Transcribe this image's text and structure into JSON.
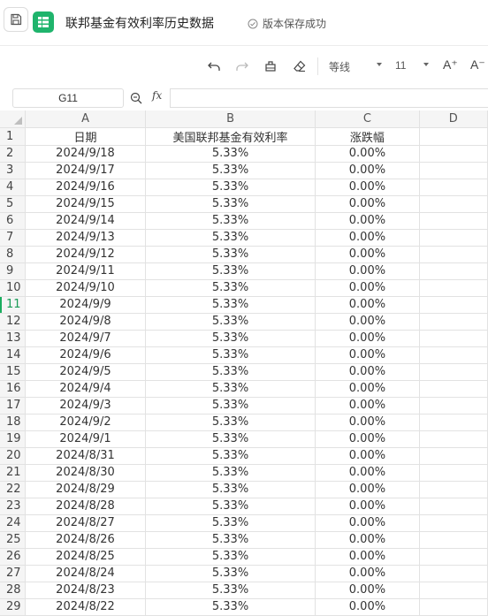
{
  "title_bar": {
    "doc_title": "联邦基金有效利率历史数据",
    "save_status": "版本保存成功"
  },
  "toolbar": {
    "font_name": "等线",
    "font_size": "11",
    "grow_font_label": "A⁺",
    "shrink_font_label": "A⁻"
  },
  "formula_bar": {
    "name_box": "G11",
    "fx_label": "fx",
    "formula": ""
  },
  "sheet": {
    "columns": [
      "A",
      "B",
      "C",
      "D"
    ],
    "selected_row": "11",
    "rows": [
      {
        "row": "1",
        "a": "日期",
        "b": "美国联邦基金有效利率",
        "c": "涨跌幅"
      },
      {
        "row": "2",
        "a": "2024/9/18",
        "b": "5.33%",
        "c": "0.00%"
      },
      {
        "row": "3",
        "a": "2024/9/17",
        "b": "5.33%",
        "c": "0.00%"
      },
      {
        "row": "4",
        "a": "2024/9/16",
        "b": "5.33%",
        "c": "0.00%"
      },
      {
        "row": "5",
        "a": "2024/9/15",
        "b": "5.33%",
        "c": "0.00%"
      },
      {
        "row": "6",
        "a": "2024/9/14",
        "b": "5.33%",
        "c": "0.00%"
      },
      {
        "row": "7",
        "a": "2024/9/13",
        "b": "5.33%",
        "c": "0.00%"
      },
      {
        "row": "8",
        "a": "2024/9/12",
        "b": "5.33%",
        "c": "0.00%"
      },
      {
        "row": "9",
        "a": "2024/9/11",
        "b": "5.33%",
        "c": "0.00%"
      },
      {
        "row": "10",
        "a": "2024/9/10",
        "b": "5.33%",
        "c": "0.00%"
      },
      {
        "row": "11",
        "a": "2024/9/9",
        "b": "5.33%",
        "c": "0.00%"
      },
      {
        "row": "12",
        "a": "2024/9/8",
        "b": "5.33%",
        "c": "0.00%"
      },
      {
        "row": "13",
        "a": "2024/9/7",
        "b": "5.33%",
        "c": "0.00%"
      },
      {
        "row": "14",
        "a": "2024/9/6",
        "b": "5.33%",
        "c": "0.00%"
      },
      {
        "row": "15",
        "a": "2024/9/5",
        "b": "5.33%",
        "c": "0.00%"
      },
      {
        "row": "16",
        "a": "2024/9/4",
        "b": "5.33%",
        "c": "0.00%"
      },
      {
        "row": "17",
        "a": "2024/9/3",
        "b": "5.33%",
        "c": "0.00%"
      },
      {
        "row": "18",
        "a": "2024/9/2",
        "b": "5.33%",
        "c": "0.00%"
      },
      {
        "row": "19",
        "a": "2024/9/1",
        "b": "5.33%",
        "c": "0.00%"
      },
      {
        "row": "20",
        "a": "2024/8/31",
        "b": "5.33%",
        "c": "0.00%"
      },
      {
        "row": "21",
        "a": "2024/8/30",
        "b": "5.33%",
        "c": "0.00%"
      },
      {
        "row": "22",
        "a": "2024/8/29",
        "b": "5.33%",
        "c": "0.00%"
      },
      {
        "row": "23",
        "a": "2024/8/28",
        "b": "5.33%",
        "c": "0.00%"
      },
      {
        "row": "24",
        "a": "2024/8/27",
        "b": "5.33%",
        "c": "0.00%"
      },
      {
        "row": "25",
        "a": "2024/8/26",
        "b": "5.33%",
        "c": "0.00%"
      },
      {
        "row": "26",
        "a": "2024/8/25",
        "b": "5.33%",
        "c": "0.00%"
      },
      {
        "row": "27",
        "a": "2024/8/24",
        "b": "5.33%",
        "c": "0.00%"
      },
      {
        "row": "28",
        "a": "2024/8/23",
        "b": "5.33%",
        "c": "0.00%"
      },
      {
        "row": "29",
        "a": "2024/8/22",
        "b": "5.33%",
        "c": "0.00%"
      }
    ]
  },
  "colors": {
    "accent": "#1fb46c",
    "header_bg": "#f5f5f5",
    "grid_line": "#e2e2e2"
  }
}
